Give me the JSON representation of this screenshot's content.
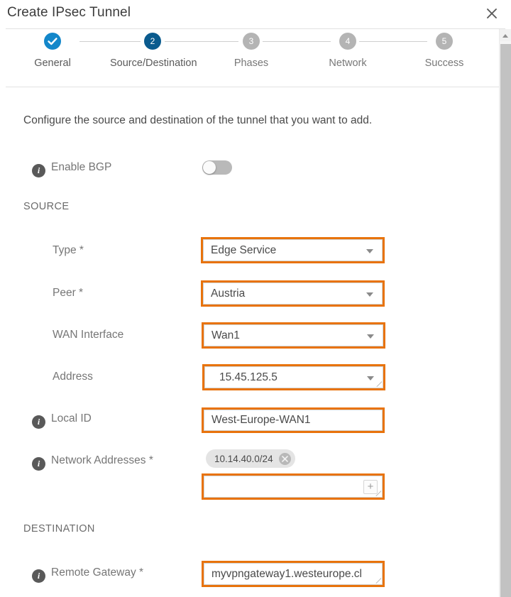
{
  "window": {
    "title": "Create IPsec Tunnel",
    "close_icon": "close-icon"
  },
  "stepper": {
    "steps": [
      {
        "num": "1",
        "label": "General",
        "state": "done"
      },
      {
        "num": "2",
        "label": "Source/Destination",
        "state": "active"
      },
      {
        "num": "3",
        "label": "Phases",
        "state": "upcoming"
      },
      {
        "num": "4",
        "label": "Network",
        "state": "upcoming"
      },
      {
        "num": "5",
        "label": "Success",
        "state": "upcoming"
      }
    ]
  },
  "body": {
    "intro": "Configure the source and destination of the tunnel that you want to add.",
    "enable_bgp": {
      "label": "Enable BGP",
      "info_icon": "info-icon",
      "toggle_state": "off"
    },
    "source_heading": "SOURCE",
    "destination_heading": "DESTINATION",
    "fields": {
      "type": {
        "label": "Type *",
        "value": "Edge Service",
        "control": "select"
      },
      "peer": {
        "label": "Peer *",
        "value": "Austria",
        "control": "select"
      },
      "wan_interface": {
        "label": "WAN Interface",
        "value": "Wan1",
        "control": "select"
      },
      "address": {
        "label": "Address",
        "value": "15.45.125.5",
        "control": "select"
      },
      "local_id": {
        "label": "Local ID",
        "value": "West-Europe-WAN1",
        "control": "text"
      },
      "network_addresses": {
        "label": "Network Addresses *",
        "chips": [
          "10.14.40.0/24"
        ],
        "input_value": "",
        "add_label": "+",
        "control": "tag-input"
      },
      "remote_gateway": {
        "label": "Remote Gateway *",
        "value": "myvpngateway1.westeurope.cl",
        "control": "text"
      }
    }
  },
  "colors": {
    "highlight": "#e8730c",
    "step_done": "#1387ca",
    "step_active": "#0a5b8e",
    "step_upcoming": "#b4b4b4"
  },
  "scrollbar": {
    "up_arrow_icon": "chevron-up-icon"
  }
}
